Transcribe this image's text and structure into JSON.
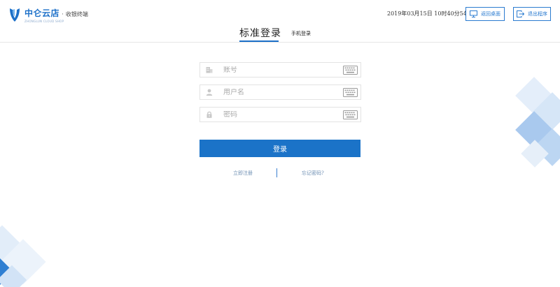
{
  "header": {
    "brand": "中仑云店",
    "separator": "·",
    "subtitle": "收银终端",
    "brand_en": "ZHONGLUN CLOUD SHOP",
    "datetime": "2019年03月15日 10时40分54秒",
    "desktop_button": "返回桌面",
    "exit_button": "退出程序"
  },
  "tabs": {
    "standard_login": "标准登录",
    "phone_login": "手机登录"
  },
  "form": {
    "account_placeholder": "账号",
    "username_placeholder": "用户名",
    "password_placeholder": "密码",
    "login_button": "登录"
  },
  "links": {
    "register": "立即注册",
    "forgot_password": "忘记密码?"
  },
  "colors": {
    "accent": "#1b6fc8",
    "button": "#1b73c8",
    "link": "#6e8fb3"
  }
}
